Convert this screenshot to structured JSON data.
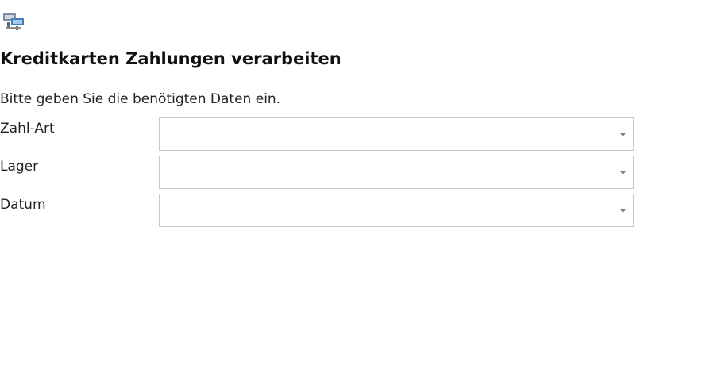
{
  "header": {
    "icon": "transfer-icon",
    "title": "Kreditkarten Zahlungen verarbeiten",
    "subtitle": "Bitte geben Sie die benötigten Daten ein."
  },
  "form": {
    "fields": [
      {
        "label": "Zahl-Art",
        "value": ""
      },
      {
        "label": "Lager",
        "value": ""
      },
      {
        "label": "Datum",
        "value": ""
      }
    ]
  },
  "colors": {
    "icon_primary": "#3f7fbf",
    "icon_secondary": "#7a7a7a",
    "border": "#c8c8c8"
  }
}
